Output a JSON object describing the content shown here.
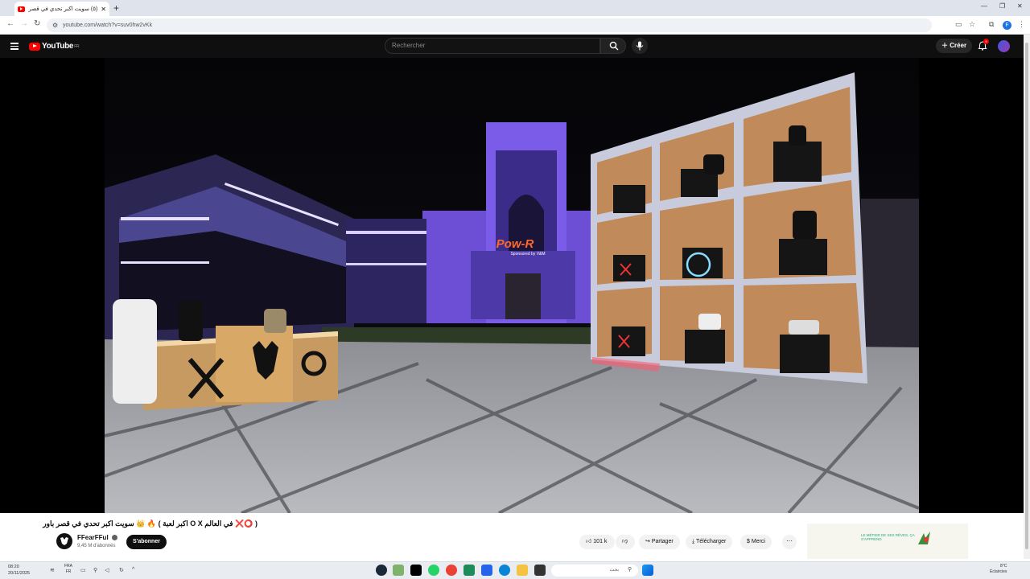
{
  "browser": {
    "tab_title": "(٥) سويت اكبر تحدي في قصر...",
    "url": "youtube.com/watch?v=suv0hw2vKk"
  },
  "youtube": {
    "logo": "YouTube",
    "region": "FR",
    "search_placeholder": "Rechercher",
    "create_label": "Créer",
    "notifications_count": "9"
  },
  "video": {
    "title": "( ⭕❌ في العالم O X اكبر لعبة ) 🔥 👑 سويت اكبر تحدي في قصر باور",
    "channel": "FFearFFul",
    "subscribers": "9,45 M d'abonnés",
    "subscribe_label": "S'abonner",
    "likes": "101 k",
    "share_label": "Partager",
    "download_label": "Télécharger",
    "thanks_label": "Merci",
    "more_label": "···",
    "scene_sign": "Pow-R",
    "scene_sign_sub": "Sponsored by V&M"
  },
  "ad": {
    "text": "LE MÉTIER DE SES RÊVES, ÇA S'APPREND"
  },
  "taskbar": {
    "time": "08:20",
    "date": "20/11/2025",
    "lang_top": "FRA",
    "lang_bottom": "FR",
    "search_placeholder": "بحث",
    "weather_temp": "8°C",
    "weather_text": "Éclaircies"
  }
}
